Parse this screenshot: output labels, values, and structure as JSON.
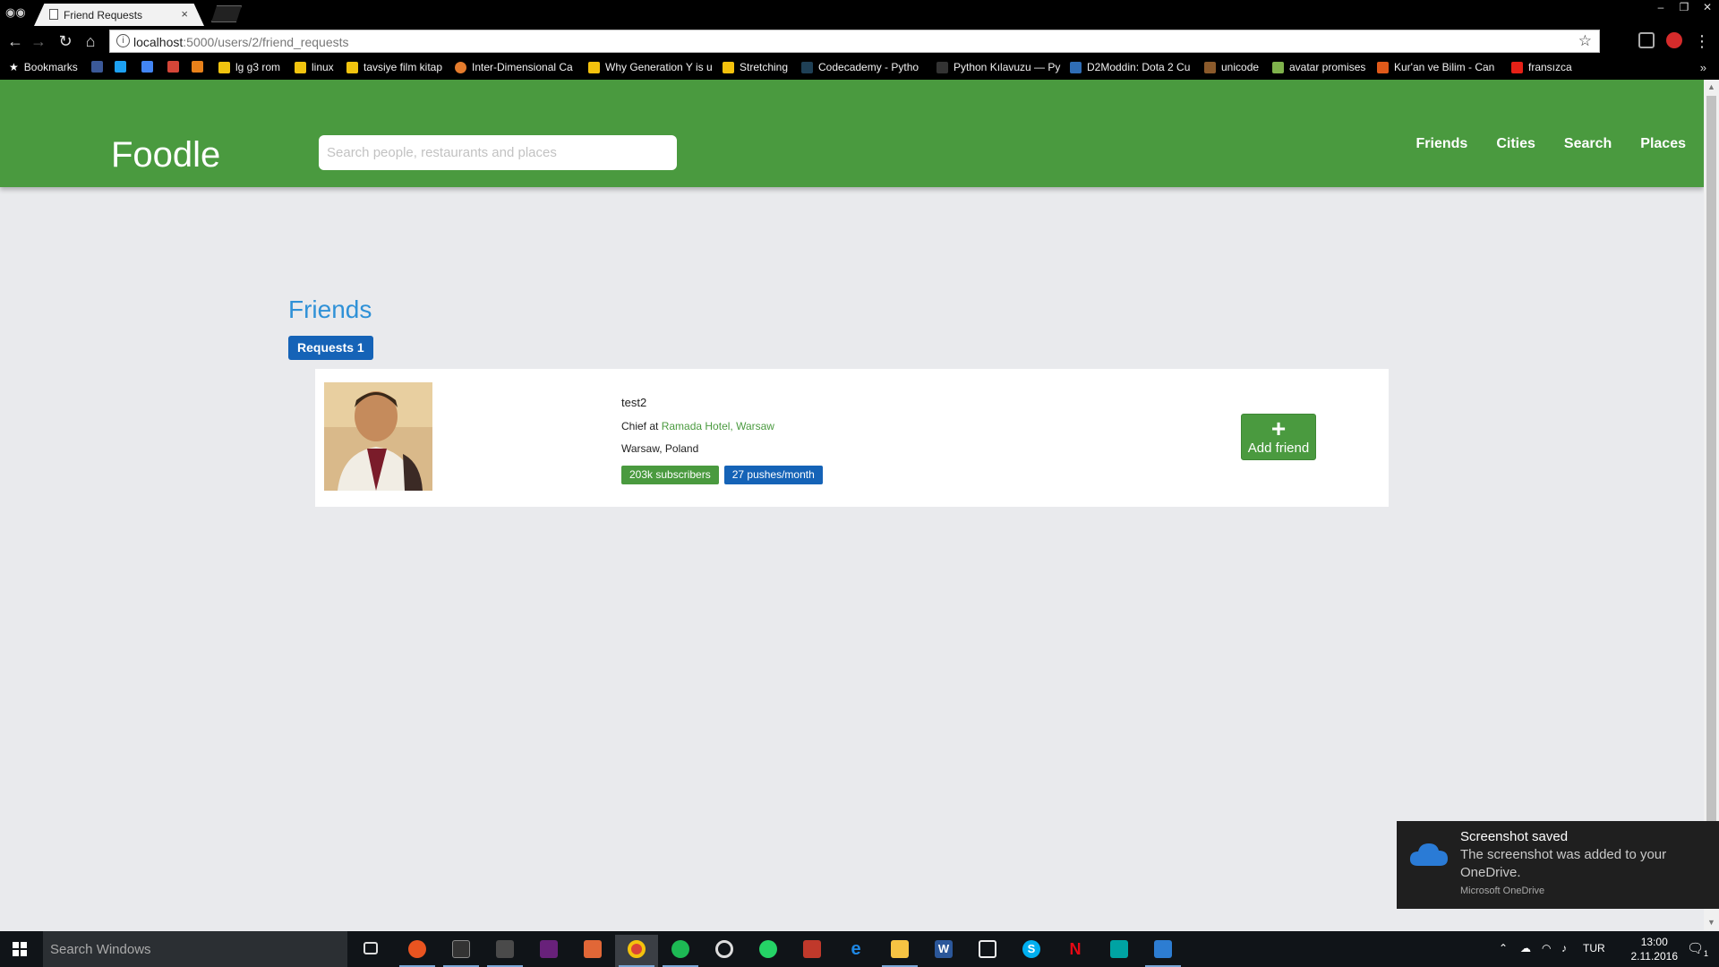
{
  "browser": {
    "tab_title": "Friend Requests",
    "tab_close": "×",
    "url_host": "localhost",
    "url_path": ":5000/users/2/friend_requests",
    "bookmarks": [
      {
        "label": "Bookmarks",
        "color": "#ffffff"
      },
      {
        "label": "",
        "color": "#3b5998"
      },
      {
        "label": "",
        "color": "#1da1f2"
      },
      {
        "label": "",
        "color": "#4285f4"
      },
      {
        "label": "",
        "color": "#d44638"
      },
      {
        "label": "",
        "color": "#e8811a"
      },
      {
        "label": "lg g3 rom",
        "color": "#f1c40f"
      },
      {
        "label": "linux",
        "color": "#f1c40f"
      },
      {
        "label": "tavsiye film kitap",
        "color": "#f1c40f"
      },
      {
        "label": "Inter-Dimensional Ca",
        "color": "#e57c2d"
      },
      {
        "label": "Why Generation Y is u",
        "color": "#f4c20d"
      },
      {
        "label": "Stretching",
        "color": "#f4c20d"
      },
      {
        "label": "Codecademy - Pytho",
        "color": "#1f4056"
      },
      {
        "label": "Python Kılavuzu — Py",
        "color": "#333333"
      },
      {
        "label": "D2Moddin: Dota 2 Cu",
        "color": "#2f6db5"
      },
      {
        "label": "unicode",
        "color": "#8b5a2b"
      },
      {
        "label": "avatar promises",
        "color": "#7fb24c"
      },
      {
        "label": "Kur'an ve Bilim - Can",
        "color": "#e05a1a"
      },
      {
        "label": "fransızca",
        "color": "#e62117"
      }
    ]
  },
  "header": {
    "brand": "Foodle",
    "search_placeholder": "Search people, restaurants and places",
    "nav": [
      "Friends",
      "Cities",
      "Search",
      "Places"
    ]
  },
  "main": {
    "title": "Friends",
    "requests_label": "Requests 1",
    "friend": {
      "name": "test2",
      "job_prefix": "Chief at ",
      "job_link": "Ramada Hotel, Warsaw",
      "location": "Warsaw, Poland",
      "badges": {
        "subscribers": "203k subscribers",
        "pushes": "27 pushes/month"
      },
      "add_label": "Add friend",
      "add_plus": "+"
    }
  },
  "toast": {
    "title": "Screenshot saved",
    "body": "The screenshot was added to your OneDrive.",
    "app": "Microsoft OneDrive"
  },
  "taskbar": {
    "search_text": "Search Windows",
    "lang": "TUR",
    "time": "13:00",
    "date": "2.11.2016",
    "notification_count": "1"
  },
  "colors": {
    "brand_green": "#4a9a3f",
    "accent_blue": "#1563b7",
    "link_blue": "#2f91d7"
  }
}
